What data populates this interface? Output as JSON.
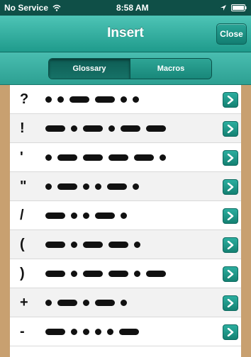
{
  "status": {
    "carrier": "No Service",
    "time": "8:58 AM"
  },
  "nav": {
    "title": "Insert",
    "close_label": "Close"
  },
  "tabs": [
    {
      "label": "Glossary",
      "selected": true
    },
    {
      "label": "Macros",
      "selected": false
    }
  ],
  "rows": [
    {
      "char": "?",
      "code": "..--.."
    },
    {
      "char": "!",
      "code": "-.-.--"
    },
    {
      "char": "'",
      "code": ".----."
    },
    {
      "char": "\"",
      "code": ".-..-."
    },
    {
      "char": "/",
      "code": "-..-."
    },
    {
      "char": "(",
      "code": "-.--."
    },
    {
      "char": ")",
      "code": "-.--.-"
    },
    {
      "char": "+",
      "code": ".-.-."
    },
    {
      "char": "-",
      "code": "-....-"
    }
  ],
  "colors": {
    "accent": "#1f9b8c",
    "statusbar": "#0f4f47",
    "wood": "#c8a070"
  }
}
